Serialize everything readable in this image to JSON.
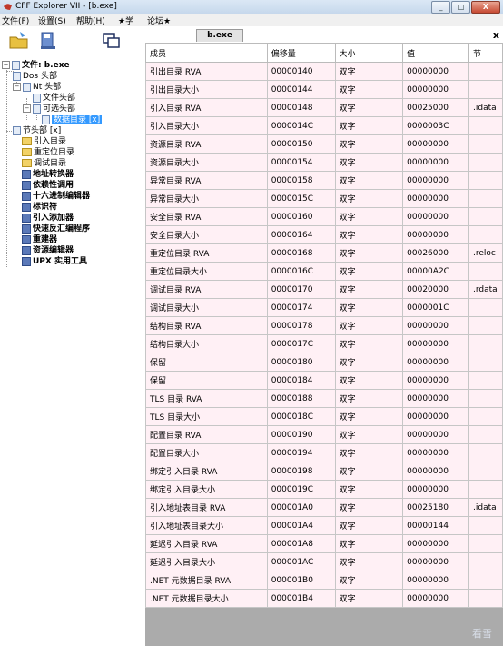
{
  "window": {
    "title": "CFF Explorer VII - [b.exe]",
    "controls": [
      "_",
      "□",
      "X"
    ]
  },
  "menu": [
    "文件(F)",
    "设置(S)",
    "帮助(H)",
    "★学",
    "论坛★"
  ],
  "tree": {
    "root": "文件: b.exe",
    "items": [
      {
        "label": "Dos 头部"
      },
      {
        "label": "Nt 头部"
      },
      {
        "label": "文件头部"
      },
      {
        "label": "可选头部"
      },
      {
        "label": "数据目录 [x]"
      },
      {
        "label": "节头部 [x]"
      },
      {
        "label": "引入目录"
      },
      {
        "label": "重定位目录"
      },
      {
        "label": "调试目录"
      },
      {
        "label": "地址转换器"
      },
      {
        "label": "依赖性调用"
      },
      {
        "label": "十六进制编辑器"
      },
      {
        "label": "标识符"
      },
      {
        "label": "引入添加器"
      },
      {
        "label": "快速反汇编程序"
      },
      {
        "label": "重建器"
      },
      {
        "label": "资源编辑器"
      },
      {
        "label": "UPX 实用工具"
      }
    ]
  },
  "tab": {
    "label": "b.exe",
    "close": "x"
  },
  "table": {
    "headers": [
      "成员",
      "偏移量",
      "大小",
      "值",
      "节"
    ],
    "rows": [
      [
        "引出目录 RVA",
        "00000140",
        "双字",
        "00000000",
        ""
      ],
      [
        "引出目录大小",
        "00000144",
        "双字",
        "00000000",
        ""
      ],
      [
        "引入目录 RVA",
        "00000148",
        "双字",
        "00025000",
        ".idata"
      ],
      [
        "引入目录大小",
        "0000014C",
        "双字",
        "0000003C",
        ""
      ],
      [
        "资源目录 RVA",
        "00000150",
        "双字",
        "00000000",
        ""
      ],
      [
        "资源目录大小",
        "00000154",
        "双字",
        "00000000",
        ""
      ],
      [
        "异常目录 RVA",
        "00000158",
        "双字",
        "00000000",
        ""
      ],
      [
        "异常目录大小",
        "0000015C",
        "双字",
        "00000000",
        ""
      ],
      [
        "安全目录 RVA",
        "00000160",
        "双字",
        "00000000",
        ""
      ],
      [
        "安全目录大小",
        "00000164",
        "双字",
        "00000000",
        ""
      ],
      [
        "重定位目录 RVA",
        "00000168",
        "双字",
        "00026000",
        ".reloc"
      ],
      [
        "重定位目录大小",
        "0000016C",
        "双字",
        "00000A2C",
        ""
      ],
      [
        "调试目录 RVA",
        "00000170",
        "双字",
        "00020000",
        ".rdata"
      ],
      [
        "调试目录大小",
        "00000174",
        "双字",
        "0000001C",
        ""
      ],
      [
        "结构目录 RVA",
        "00000178",
        "双字",
        "00000000",
        ""
      ],
      [
        "结构目录大小",
        "0000017C",
        "双字",
        "00000000",
        ""
      ],
      [
        "保留",
        "00000180",
        "双字",
        "00000000",
        ""
      ],
      [
        "保留",
        "00000184",
        "双字",
        "00000000",
        ""
      ],
      [
        "TLS 目录 RVA",
        "00000188",
        "双字",
        "00000000",
        ""
      ],
      [
        "TLS 目录大小",
        "0000018C",
        "双字",
        "00000000",
        ""
      ],
      [
        "配置目录 RVA",
        "00000190",
        "双字",
        "00000000",
        ""
      ],
      [
        "配置目录大小",
        "00000194",
        "双字",
        "00000000",
        ""
      ],
      [
        "绑定引入目录 RVA",
        "00000198",
        "双字",
        "00000000",
        ""
      ],
      [
        "绑定引入目录大小",
        "0000019C",
        "双字",
        "00000000",
        ""
      ],
      [
        "引入地址表目录 RVA",
        "000001A0",
        "双字",
        "00025180",
        ".idata"
      ],
      [
        "引入地址表目录大小",
        "000001A4",
        "双字",
        "00000144",
        ""
      ],
      [
        "延迟引入目录 RVA",
        "000001A8",
        "双字",
        "00000000",
        ""
      ],
      [
        "延迟引入目录大小",
        "000001AC",
        "双字",
        "00000000",
        ""
      ],
      [
        ".NET 元数据目录 RVA",
        "000001B0",
        "双字",
        "00000000",
        ""
      ],
      [
        ".NET 元数据目录大小",
        "000001B4",
        "双字",
        "00000000",
        ""
      ]
    ]
  },
  "watermark": "看雪",
  "colors": {
    "row_bg": "#fff0f5",
    "selection": "#3399ff",
    "pane_bg": "#ababab"
  }
}
